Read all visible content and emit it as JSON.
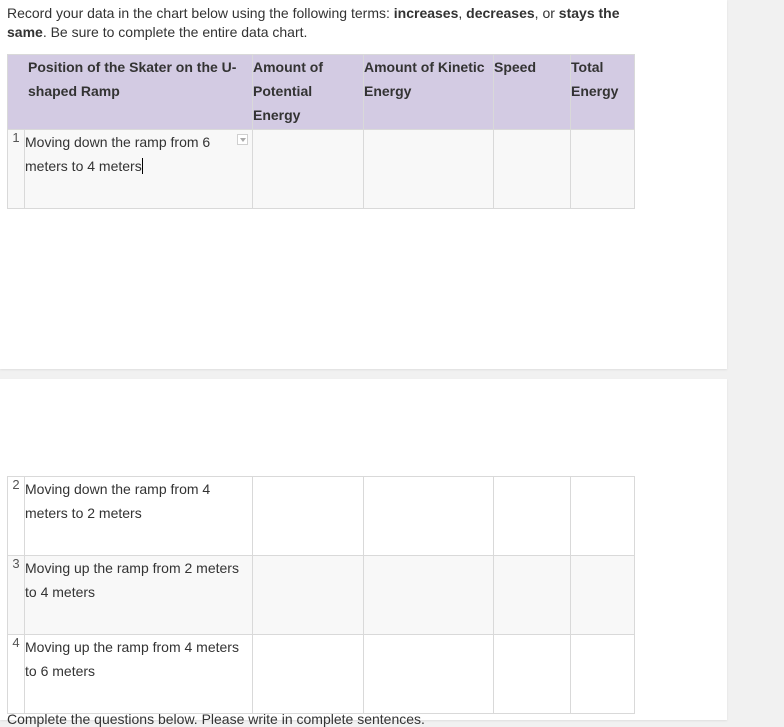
{
  "instructions": {
    "part1": "Record your data in the chart below using the following terms: ",
    "term1": "increases",
    "sep1": ", ",
    "term2": "decreases",
    "sep2": ", or ",
    "term3": "stays the same",
    "part2": ". Be sure to complete the entire data chart."
  },
  "table": {
    "headers": [
      "Position of the Skater on the U-shaped Ramp",
      "Amount of Potential Energy",
      "Amount of Kinetic Energy",
      "Speed",
      "Total Energy"
    ],
    "rows": [
      {
        "num": "1",
        "position": "Moving down the ramp from 6 meters to 4 meters"
      },
      {
        "num": "2",
        "position": "Moving down the ramp from 4 meters to 2 meters"
      },
      {
        "num": "3",
        "position": "Moving up the ramp from 2 meters to 4 meters"
      },
      {
        "num": "4",
        "position": "Moving up the ramp from 4 meters to 6 meters"
      }
    ]
  },
  "footer": {
    "text": "Complete the questions below. Please write in complete sentences."
  }
}
